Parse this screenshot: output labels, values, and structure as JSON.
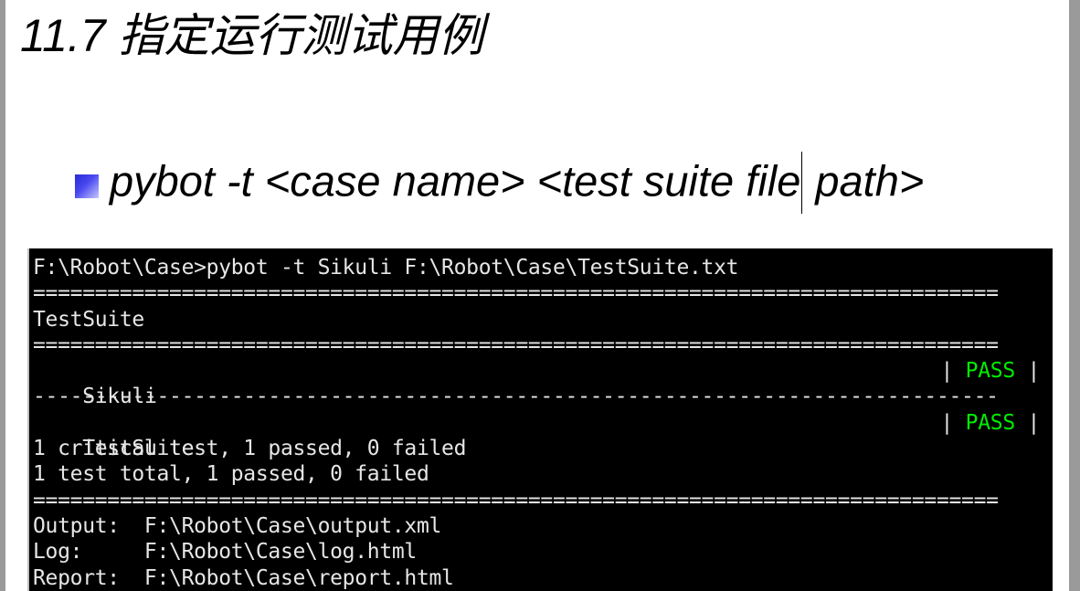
{
  "slide": {
    "title": "11.7 指定运行测试用例",
    "bullet": {
      "before_caret": "pybot -t <case name> <test suite file",
      "after_caret": " path>"
    }
  },
  "console": {
    "lines": {
      "command": "F:\\Robot\\Case>pybot -t Sikuli F:\\Robot\\Case\\TestSuite.txt",
      "sep1": "==============================================================================",
      "suite_header": "TestSuite",
      "sep2": "==============================================================================",
      "test_name": "Sikuli",
      "sep3": "------------------------------------------------------------------------------",
      "suite_result_name": "TestSuite",
      "critical_summary": "1 critical test, 1 passed, 0 failed",
      "total_summary": "1 test total, 1 passed, 0 failed",
      "sep4": "==============================================================================",
      "output": "Output:  F:\\Robot\\Case\\output.xml",
      "log": "Log:     F:\\Robot\\Case\\log.html",
      "report": "Report:  F:\\Robot\\Case\\report.html"
    },
    "status": {
      "bar": "|",
      "test_status": "PASS",
      "suite_status": "PASS"
    },
    "colors": {
      "background": "#000000",
      "text": "#e6e6e6",
      "pass": "#00ee00"
    }
  }
}
